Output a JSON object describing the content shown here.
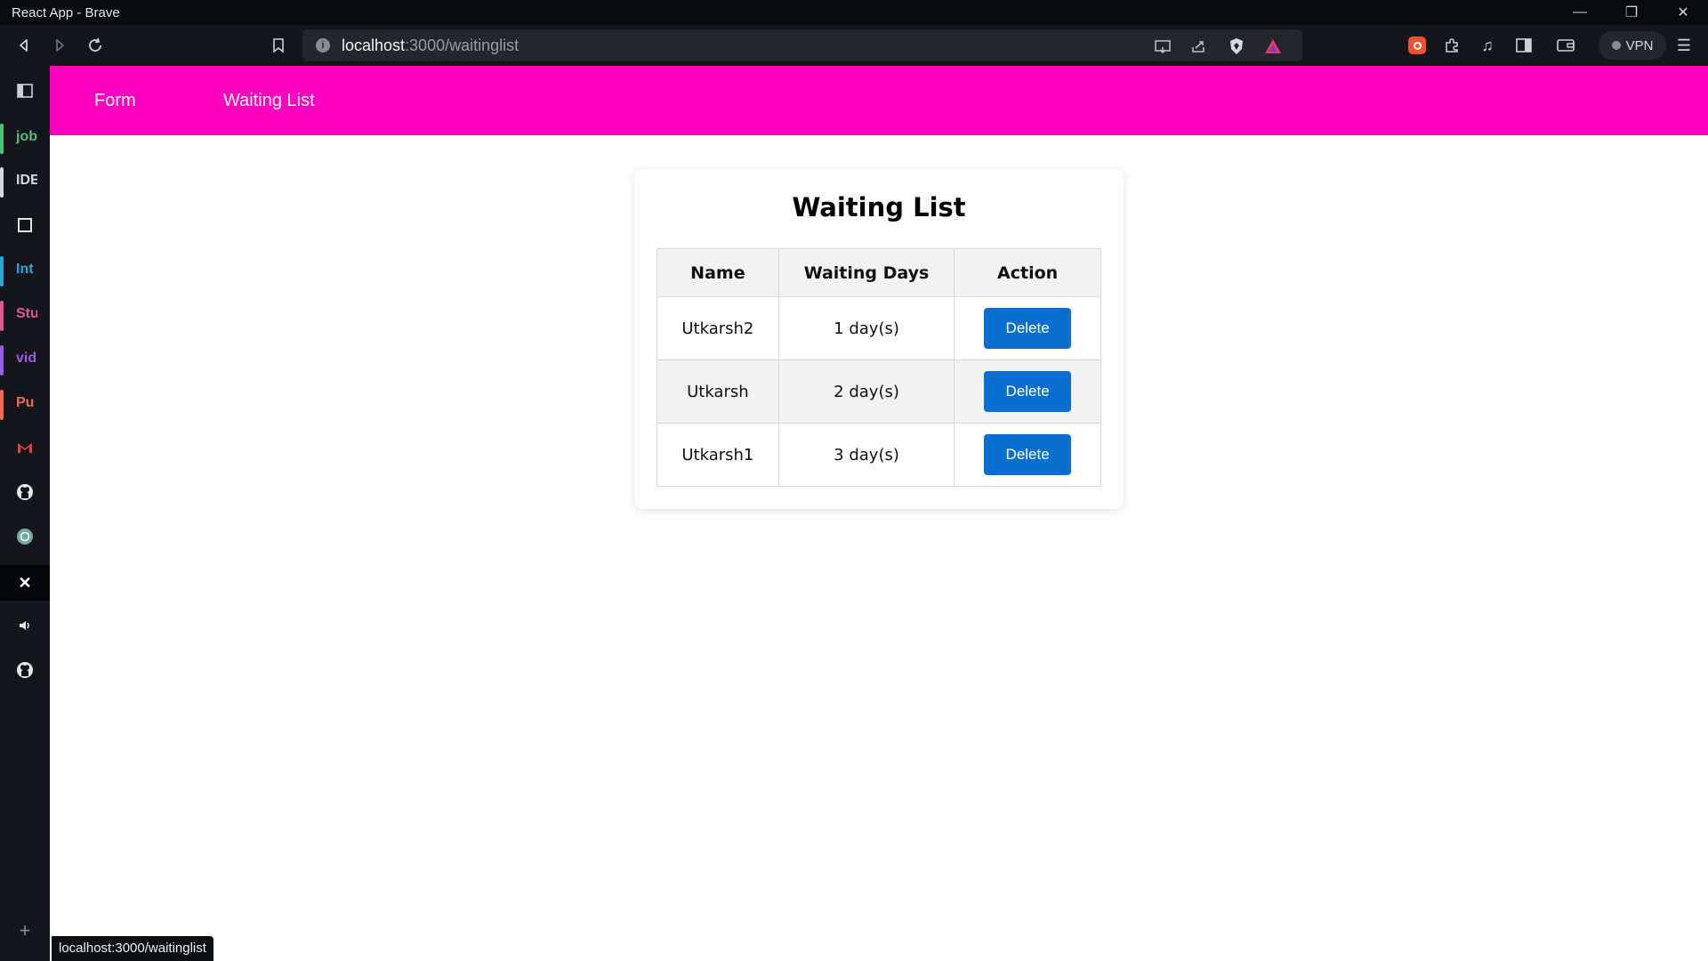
{
  "window": {
    "title": "React App - Brave"
  },
  "toolbar": {
    "url_host": "localhost",
    "url_path": ":3000/waitinglist",
    "vpn_label": "VPN"
  },
  "sidebar": {
    "items": [
      {
        "label": "job",
        "color": "#4fc37a"
      },
      {
        "label": "IDE",
        "color": "#d6d7db"
      },
      {
        "label": "Int",
        "color": "#2fa6d6"
      },
      {
        "label": "Stu",
        "color": "#e05a8c"
      },
      {
        "label": "vid",
        "color": "#9b5de5"
      },
      {
        "label": "Pu",
        "color": "#f26a4f"
      }
    ]
  },
  "nav": {
    "links": [
      "Form",
      "Waiting List"
    ],
    "background": "#ff00c0"
  },
  "card": {
    "title": "Waiting List",
    "columns": [
      "Name",
      "Waiting Days",
      "Action"
    ],
    "rows": [
      {
        "name": "Utkarsh2",
        "days": "1 day(s)",
        "action": "Delete"
      },
      {
        "name": "Utkarsh",
        "days": "2 day(s)",
        "action": "Delete"
      },
      {
        "name": "Utkarsh1",
        "days": "3 day(s)",
        "action": "Delete"
      }
    ],
    "button_color": "#0a6fd0"
  },
  "statusbar": {
    "text": "localhost:3000/waitinglist"
  }
}
